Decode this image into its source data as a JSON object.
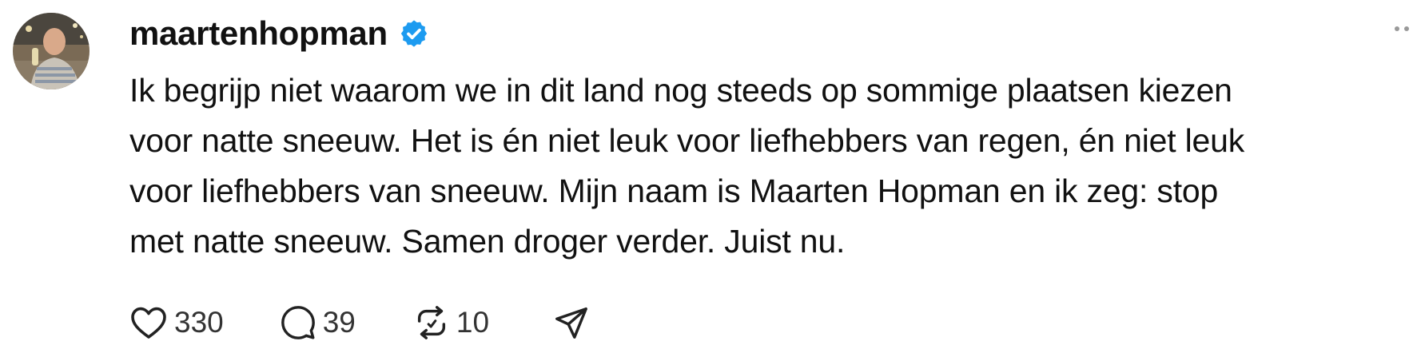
{
  "post": {
    "author": {
      "username": "maartenhopman",
      "verified": true,
      "avatar_icon": "user-avatar-photo"
    },
    "text_lines": [
      "Ik begrijp niet waarom we in dit land nog steeds op sommige plaatsen kiezen",
      "voor natte sneeuw. Het is én niet leuk voor liefhebbers van regen, én niet leuk",
      "voor liefhebbers van sneeuw. Mijn naam is Maarten Hopman en ik zeg: stop",
      "met natte sneeuw. Samen droger verder. Juist nu."
    ],
    "actions": {
      "like_count": "330",
      "reply_count": "39",
      "repost_count": "10",
      "icons": [
        "heart-icon",
        "comment-icon",
        "repost-icon",
        "share-icon"
      ]
    }
  },
  "colors": {
    "verified_badge": "#1d9bf0",
    "text": "#111111",
    "icon": "#222222"
  }
}
